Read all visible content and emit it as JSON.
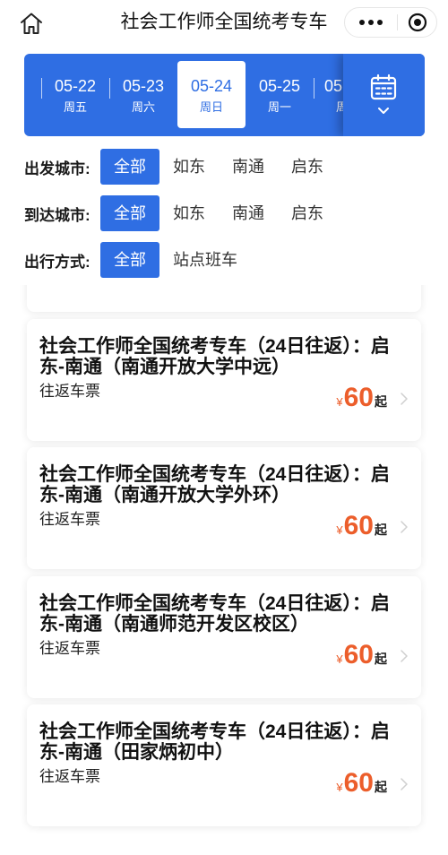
{
  "header": {
    "title": "社会工作师全国统考专车",
    "icons": [
      "home-icon",
      "more-dots-icon",
      "target-circle-icon"
    ]
  },
  "date_bar": {
    "dates": [
      {
        "date": "05-22",
        "weekday": "周五",
        "selected": false
      },
      {
        "date": "05-23",
        "weekday": "周六",
        "selected": false
      },
      {
        "date": "05-24",
        "weekday": "周日",
        "selected": true
      },
      {
        "date": "05-25",
        "weekday": "周一",
        "selected": false
      },
      {
        "date": "05",
        "weekday": "周",
        "selected": false
      }
    ],
    "icons": [
      "calendar-icon",
      "chevron-down-icon"
    ]
  },
  "filters": [
    {
      "label": "出发城市:",
      "options": [
        "全部",
        "如东",
        "南通",
        "启东"
      ],
      "selected": "全部"
    },
    {
      "label": "到达城市:",
      "options": [
        "全部",
        "如东",
        "南通",
        "启东"
      ],
      "selected": "全部"
    },
    {
      "label": "出行方式:",
      "options": [
        "全部",
        "站点班车"
      ],
      "selected": "全部"
    }
  ],
  "trips": [
    {
      "title": "社会工作师全国统考专车（24日往返）：启东-南通（南通开放大学中远）",
      "ticket_type": "往返车票",
      "currency": "¥",
      "price": "60",
      "price_suffix": "起"
    },
    {
      "title": "社会工作师全国统考专车（24日往返）：启东-南通（南通开放大学外环）",
      "ticket_type": "往返车票",
      "currency": "¥",
      "price": "60",
      "price_suffix": "起"
    },
    {
      "title": "社会工作师全国统考专车（24日往返）：启东-南通（南通师范开发区校区）",
      "ticket_type": "往返车票",
      "currency": "¥",
      "price": "60",
      "price_suffix": "起"
    },
    {
      "title": "社会工作师全国统考专车（24日往返）：启东-南通（田家炳初中）",
      "ticket_type": "往返车票",
      "currency": "¥",
      "price": "60",
      "price_suffix": "起"
    }
  ],
  "colors": {
    "accent": "#2f6ee3",
    "price": "#ec5e2b"
  }
}
